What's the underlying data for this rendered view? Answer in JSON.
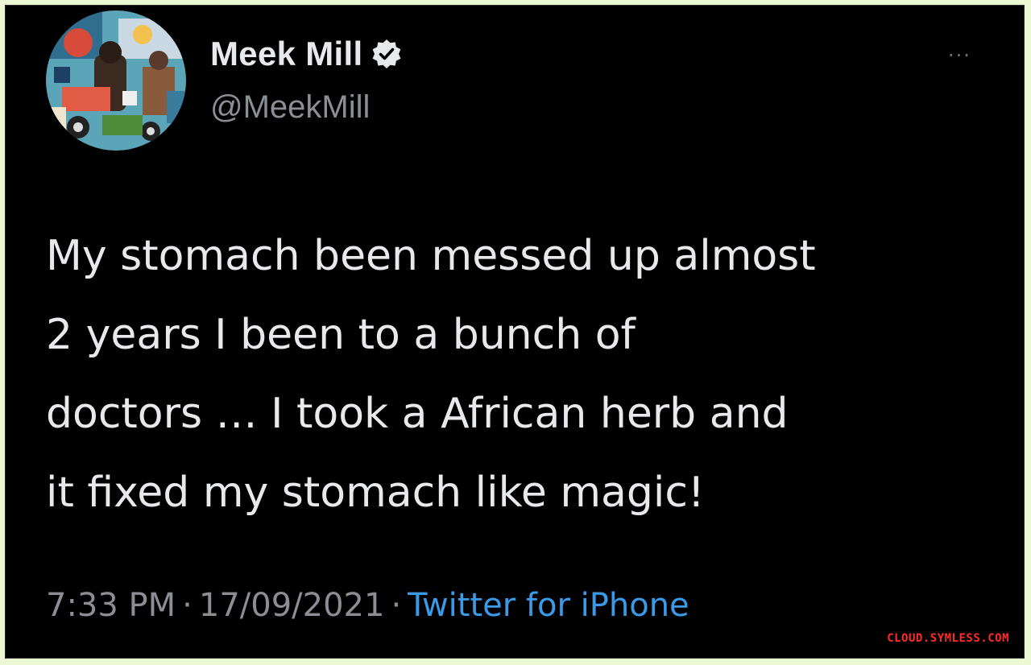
{
  "tweet": {
    "author": {
      "display_name": "Meek Mill",
      "handle": "@MeekMill",
      "verified": true
    },
    "text_lines": [
      "My stomach been messed up almost",
      "2 years I been to a bunch of",
      "doctors … I took a African herb and",
      "it fixed my stomach like magic!"
    ],
    "time": "7:33 PM",
    "date": "17/09/2021",
    "separator": "·",
    "source": "Twitter for iPhone",
    "more_label": "···"
  },
  "watermark": "CLOUD.SYMLESS.COM",
  "colors": {
    "background": "#000000",
    "text": "#e7e9ea",
    "muted": "#8b8f93",
    "link": "#3b9ae8",
    "page_border": "#ecf7d3",
    "watermark": "#ff2a2a"
  },
  "icons": {
    "verified": "verified-badge-icon",
    "more": "more-options-icon"
  }
}
